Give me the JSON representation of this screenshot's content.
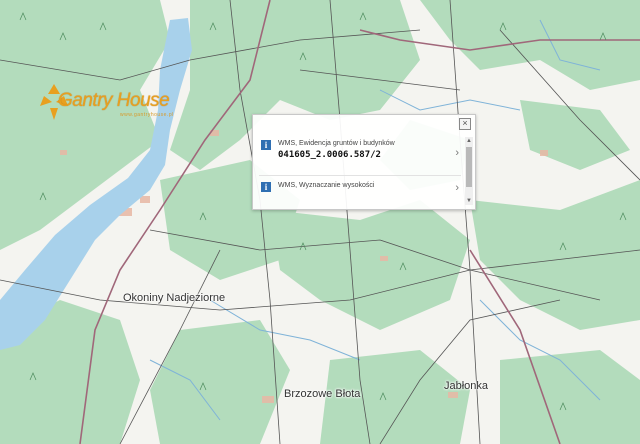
{
  "map": {
    "colors": {
      "background": "#f4f4f0",
      "forest": "#b3dcbc",
      "water": "#a8d1eb",
      "road": "#a0677a",
      "track": "#555555",
      "built": "#e8b7a4",
      "stream": "#7fb3d8"
    },
    "places": {
      "okoniny": "Okoniny Nadjeziorne",
      "brzozowe": "Brzozowe Błota",
      "jablonka": "Jabłonka"
    }
  },
  "logo": {
    "name": "Gantry House",
    "sub": "www.gantryhouse.pl"
  },
  "popup": {
    "close_label": "×",
    "items": [
      {
        "source": "WMS, Ewidencja gruntów i budynków",
        "value": "041605_2.0006.587/2",
        "chevron": "›",
        "icon": "info-icon"
      },
      {
        "source": "WMS, Wyznaczanie wysokości",
        "chevron": "›",
        "icon": "info-icon"
      }
    ]
  }
}
